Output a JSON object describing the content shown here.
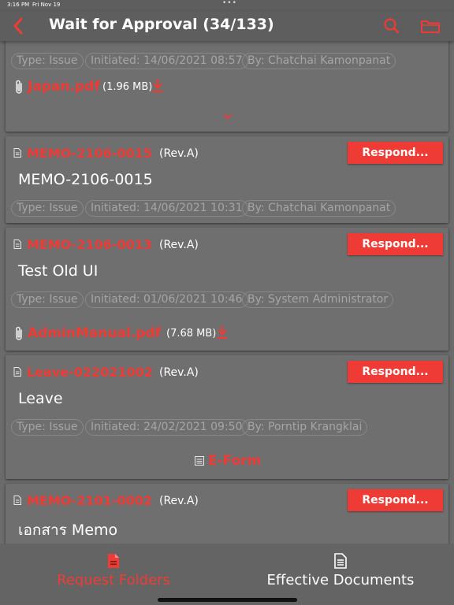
{
  "status_bar": {
    "time": "3:16 PM",
    "date": "Fri Nov 19"
  },
  "header": {
    "title": "Wait for Approval (34/133)"
  },
  "colors": {
    "accent": "#ef3b36",
    "background": "#6b6b6b",
    "card": "#6f6f6f",
    "header": "#5e5e5e"
  },
  "cards": [
    {
      "type_chip": "Type: Issue",
      "initiated_chip": "Initiated: 14/06/2021 08:57",
      "by_chip": "By: Chatchai Kamonpanat",
      "attachment": {
        "name": "Japan.pdf",
        "size": "(1.96 MB)"
      }
    },
    {
      "doc_no": "MEMO-2106-0015",
      "rev": "(Rev.A)",
      "respond_label": "Respond...",
      "subject": "MEMO-2106-0015",
      "type_chip": "Type: Issue",
      "initiated_chip": "Initiated: 14/06/2021 10:31",
      "by_chip": "By: Chatchai Kamonpanat"
    },
    {
      "doc_no": "MEMO-2106-0013",
      "rev": "(Rev.A)",
      "respond_label": "Respond...",
      "subject": "Test Old UI",
      "type_chip": "Type: Issue",
      "initiated_chip": "Initiated: 01/06/2021 10:46",
      "by_chip": "By: System Administrator",
      "attachment": {
        "name": "AdminManual.pdf",
        "size": "(7.68 MB)"
      }
    },
    {
      "doc_no": "Leave-022021002",
      "rev": "(Rev.A)",
      "respond_label": "Respond...",
      "subject": "Leave",
      "type_chip": "Type: Issue",
      "initiated_chip": "Initiated: 24/02/2021 09:50",
      "by_chip": "By: Porntip Krangklai",
      "eform_label": "E-Form"
    },
    {
      "doc_no": "MEMO-2101-0002",
      "rev": "(Rev.A)",
      "respond_label": "Respond...",
      "subject": "เอกสาร Memo"
    }
  ],
  "tabs": [
    {
      "label": "Request Folders",
      "active": true,
      "icon": "pdf-file-icon"
    },
    {
      "label": "Effective Documents",
      "active": false,
      "icon": "document-icon"
    }
  ]
}
